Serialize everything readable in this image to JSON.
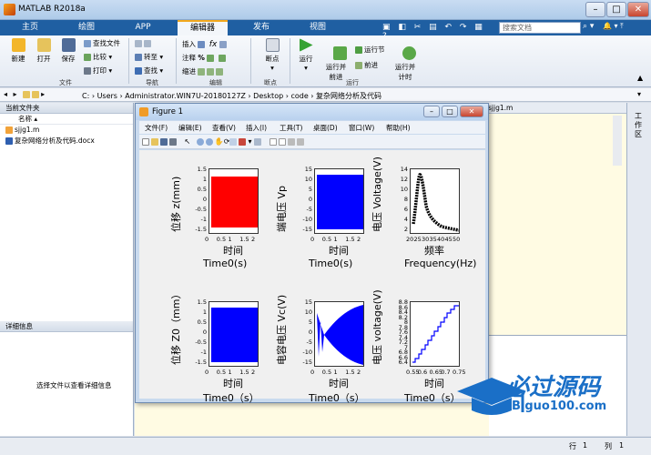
{
  "app": {
    "title": "MATLAB R2018a"
  },
  "tabs": [
    {
      "label": "主页"
    },
    {
      "label": "绘图"
    },
    {
      "label": "APP"
    },
    {
      "label": "编辑器"
    },
    {
      "label": "发布"
    },
    {
      "label": "视图"
    }
  ],
  "search": {
    "placeholder": "搜索文档"
  },
  "ribbon": {
    "file": {
      "new": "新建",
      "open": "打开",
      "save": "保存",
      "find_files": "查找文件",
      "compare": "比较",
      "print": "打印",
      "group": "文件"
    },
    "navigate": {
      "goto": "转至",
      "find": "查找",
      "group": "导航"
    },
    "edit": {
      "insert": "插入",
      "comment": "注释",
      "indent": "缩进",
      "group": "编辑"
    },
    "breakpoints": {
      "label": "断点",
      "group": "断点"
    },
    "run": {
      "run": "运行",
      "run_advance": "运行并\n前进",
      "run_section": "运行节",
      "advance": "前进",
      "run_time": "运行并\n计时",
      "group": "运行"
    }
  },
  "address": {
    "path": "C: › Users › Administrator.WIN7U-20180127Z › Desktop › code › 复杂网络分析及代码"
  },
  "file_browser": {
    "title": "当前文件夹",
    "column": "名称",
    "files": [
      {
        "name": "sjjg1.m"
      },
      {
        "name": "复杂网络分析及代码.docx"
      }
    ]
  },
  "details": {
    "title": "详细信息",
    "hint": "选择文件以查看详细信息"
  },
  "editor": {
    "tab": "sjjg1.m"
  },
  "right_panel": {
    "label": "工作区"
  },
  "status": {
    "row_label": "行",
    "row": "1",
    "col_label": "列",
    "col": "1"
  },
  "figure": {
    "title": "Figure 1",
    "menu": [
      "文件(F)",
      "编辑(E)",
      "查看(V)",
      "插入(I)",
      "工具(T)",
      "桌面(D)",
      "窗口(W)",
      "帮助(H)"
    ],
    "plots": [
      {
        "ylabel": "位移 z(mm)",
        "xtitle": "时间",
        "xsub": "Time0(s)",
        "yticks": [
          "1.5",
          "1",
          "0.5",
          "0",
          "-0.5",
          "-1",
          "-1.5"
        ],
        "xticks": [
          "0",
          "0.5",
          "1",
          "1.5",
          "2"
        ],
        "color": "#ff0000"
      },
      {
        "ylabel": "端电压 Vp",
        "xtitle": "时间",
        "xsub": "Time0(s)",
        "yticks": [
          "15",
          "10",
          "5",
          "0",
          "-5",
          "-10",
          "-15"
        ],
        "xticks": [
          "0",
          "0.5",
          "1",
          "1.5",
          "2"
        ],
        "color": "#0000ff"
      },
      {
        "ylabel": "电压 Voltage(V)",
        "xtitle": "频率",
        "xsub": "Frequency(Hz)",
        "yticks": [
          "14",
          "12",
          "10",
          "8",
          "6",
          "4",
          "2"
        ],
        "xticks": [
          "20",
          "25",
          "30",
          "35",
          "40",
          "45",
          "50"
        ],
        "color": "#000000"
      },
      {
        "ylabel": "位移 Z0（mm）",
        "xtitle": "时间",
        "xsub": "Time0（s）",
        "yticks": [
          "1.5",
          "1",
          "0.5",
          "0",
          "-0.5",
          "-1",
          "-1.5"
        ],
        "xticks": [
          "0",
          "0.5",
          "1",
          "1.5",
          "2"
        ],
        "color": "#0000ff"
      },
      {
        "ylabel": "电容电压 Vc(V)",
        "xtitle": "时间",
        "xsub": "Time0（s）",
        "yticks": [
          "15",
          "10",
          "5",
          "0",
          "-5",
          "-10",
          "-15"
        ],
        "xticks": [
          "0",
          "0.5",
          "1",
          "1.5",
          "2"
        ],
        "color": "#0000ff"
      },
      {
        "ylabel": "电压 voltage(V)",
        "xtitle": "时间",
        "xsub": "Time0（s）",
        "yticks": [
          "8.8",
          "8.6",
          "8.4",
          "8.2",
          "8",
          "7.8",
          "7.6",
          "7.4",
          "7.2",
          "7",
          "6.8",
          "6.6",
          "6.4"
        ],
        "xticks": [
          "0.55",
          "0.6",
          "0.65",
          "0.7",
          "0.75"
        ],
        "color": "#0000ff"
      }
    ]
  },
  "watermark": {
    "title": "必过源码",
    "url": "Biguo100.com"
  }
}
